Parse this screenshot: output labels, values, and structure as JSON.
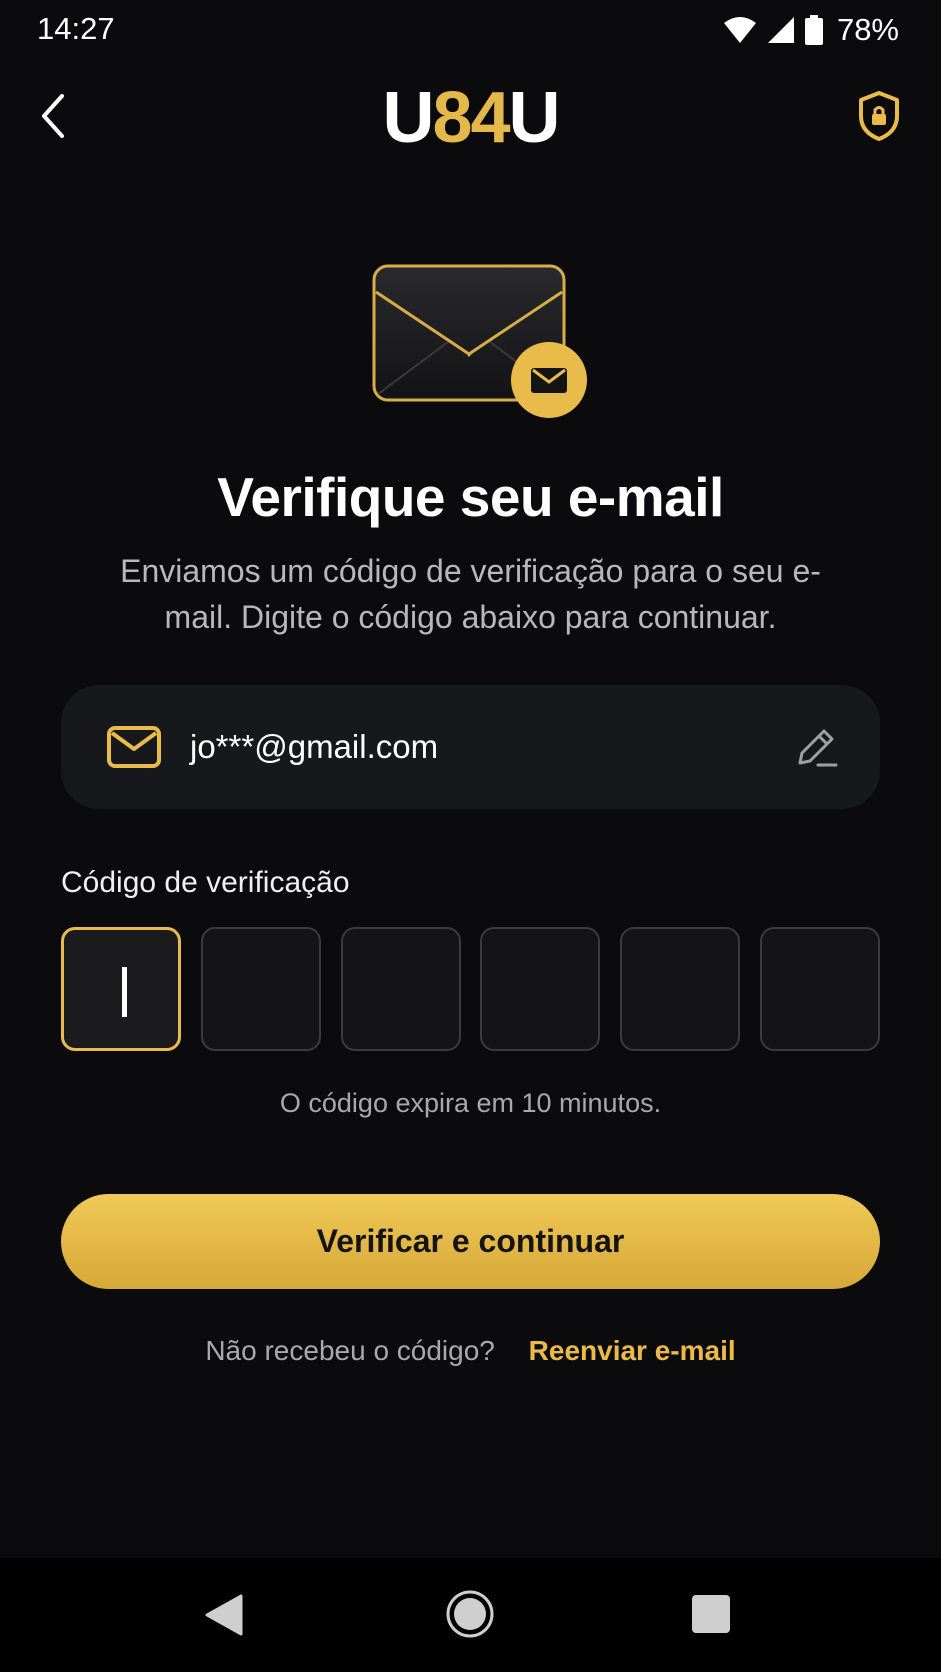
{
  "status_bar": {
    "time": "14:27",
    "battery": "78%"
  },
  "header": {
    "logo_part1": "U",
    "logo_part2": "84",
    "logo_part3": "U"
  },
  "main": {
    "title": "Verifique seu e-mail",
    "subtitle": "Enviamos um código de verificação para o seu e-mail. Digite o código abaixo para continuar.",
    "email": "jo***@gmail.com",
    "code_label": "Código de verificação",
    "code_digits": [
      "",
      "",
      "",
      "",
      "",
      ""
    ],
    "expires_text": "O código expira em 10 minutos.",
    "verify_button": "Verificar e continuar",
    "resend_question": "Não recebeu o código?",
    "resend_link": "Reenviar e-mail"
  },
  "colors": {
    "accent": "#e9bb4a",
    "background": "#0b0b0d",
    "card": "#17181c"
  },
  "icons": {
    "back": "chevron-left-icon",
    "security": "shield-lock-icon",
    "hero": "envelope-icon",
    "email_field": "mail-icon",
    "edit": "pencil-icon"
  }
}
